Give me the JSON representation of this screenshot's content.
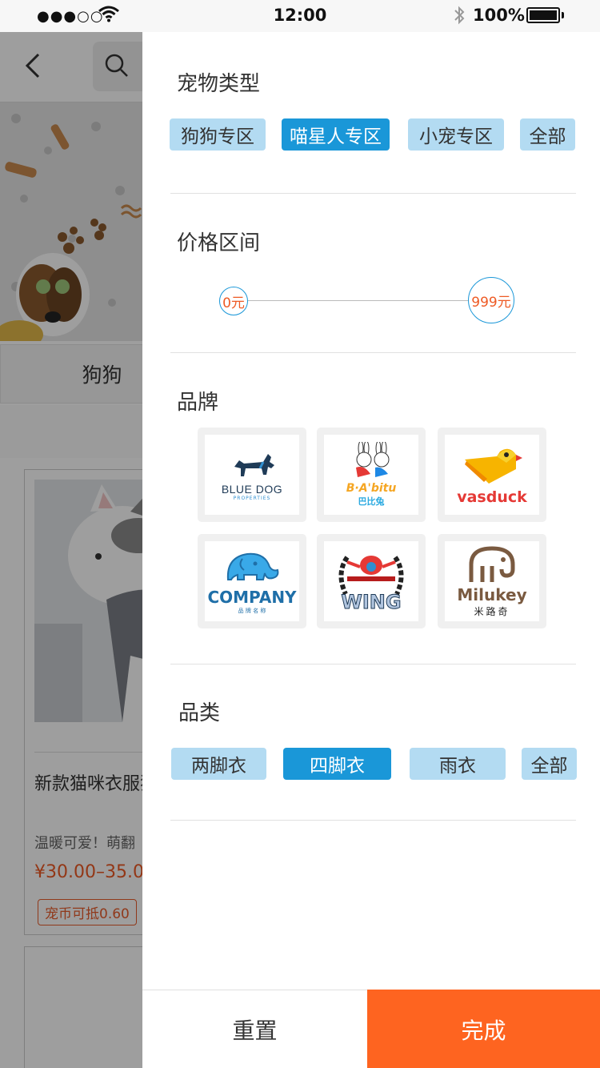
{
  "status_bar": {
    "time": "12:00",
    "battery_pct": "100%",
    "signal_icon": "●●●○○"
  },
  "background_page": {
    "active_tab": "狗狗",
    "card": {
      "title": "新款猫咪衣服猫衣服...",
      "desc": "温暖可爱！萌翻",
      "price": "¥30.00–35.0",
      "coupon": "宠币可抵0.60"
    }
  },
  "filter": {
    "pet_type": {
      "title": "宠物类型",
      "options": [
        {
          "label": "狗狗专区",
          "selected": false
        },
        {
          "label": "喵星人专区",
          "selected": true
        },
        {
          "label": "小宠专区",
          "selected": false
        },
        {
          "label": "全部",
          "selected": false
        }
      ]
    },
    "price": {
      "title": "价格区间",
      "min_label": "0元",
      "max_label": "999元"
    },
    "brand": {
      "title": "品牌",
      "items": [
        {
          "name": "BLUE DOG",
          "sub": "PROPERTIES",
          "icon": "scottie-dog-icon"
        },
        {
          "name": "B·A'bitu",
          "sub": "巴比兔",
          "icon": "rabbit-couple-icon"
        },
        {
          "name": "vasduck",
          "sub": "™",
          "icon": "duck-icon"
        },
        {
          "name": "COMPANY",
          "sub": "品 牌 名 称",
          "icon": "elephant-icon"
        },
        {
          "name": "WING",
          "sub": "",
          "icon": "wreath-icon"
        },
        {
          "name": "Milukey",
          "sub": "米路奇",
          "icon": "elephant-outline-icon"
        }
      ]
    },
    "category": {
      "title": "品类",
      "options": [
        {
          "label": "两脚衣",
          "selected": false
        },
        {
          "label": "四脚衣",
          "selected": true
        },
        {
          "label": "雨衣",
          "selected": false
        },
        {
          "label": "全部",
          "selected": false
        }
      ]
    }
  },
  "actions": {
    "reset_label": "重置",
    "done_label": "完成"
  },
  "colors": {
    "chip": "#b3dbf2",
    "chip_active": "#1a97d8",
    "done": "#fe6420",
    "price_text": "#ee5a24"
  }
}
